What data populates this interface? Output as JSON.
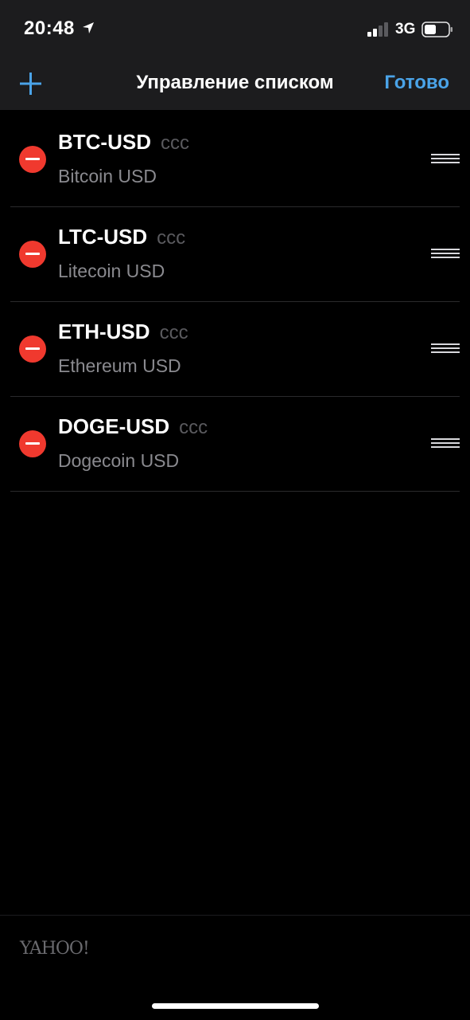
{
  "status_bar": {
    "time": "20:48",
    "network": "3G",
    "icons": [
      "location-arrow-icon",
      "signal-icon",
      "battery-icon"
    ]
  },
  "nav": {
    "title": "Управление списком",
    "done_label": "Готово",
    "add_icon": "plus-icon"
  },
  "colors": {
    "accent": "#4aa3e8",
    "delete": "#f0392e",
    "background": "#000000",
    "header_bg": "#1c1c1e"
  },
  "list": {
    "items": [
      {
        "symbol": "BTC-USD",
        "exchange": "CCC",
        "name": "Bitcoin USD"
      },
      {
        "symbol": "LTC-USD",
        "exchange": "CCC",
        "name": "Litecoin USD"
      },
      {
        "symbol": "ETH-USD",
        "exchange": "CCC",
        "name": "Ethereum USD"
      },
      {
        "symbol": "DOGE-USD",
        "exchange": "CCC",
        "name": "Dogecoin USD"
      }
    ]
  },
  "footer": {
    "logo": "YAHOO!"
  }
}
